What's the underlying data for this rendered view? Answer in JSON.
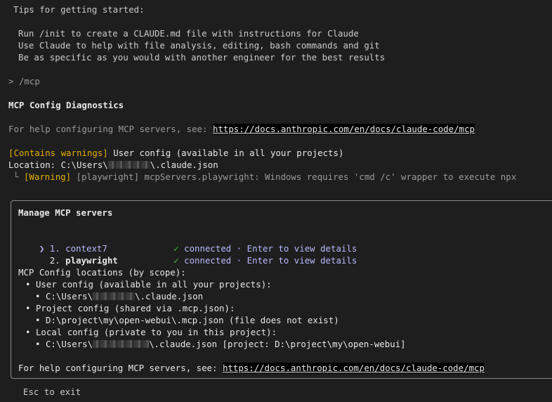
{
  "tips": {
    "heading": "Tips for getting started:",
    "items": [
      "Run /init to create a CLAUDE.md file with instructions for Claude",
      "Use Claude to help with file analysis, editing, bash commands and git",
      "Be as specific as you would with another engineer for the best results"
    ]
  },
  "prompt": {
    "symbol": ">",
    "command": "/mcp"
  },
  "diagnostics": {
    "title": "MCP Config Diagnostics",
    "help_prefix": "For help configuring MCP servers, see: ",
    "help_link": "https://docs.anthropic.com/en/docs/claude-code/mcp",
    "warning_tag": "[Contains warnings]",
    "warning_scope": " User config (available in all your projects)",
    "location_prefix": "Location: C:\\Users\\",
    "location_suffix": "\\.claude.json",
    "tree_glyph": "└",
    "item_tag": "[Warning]",
    "item_text": " [playwright] mcpServers.playwright: Windows requires 'cmd /c' wrapper to execute npx"
  },
  "panel": {
    "title": "Manage MCP servers",
    "servers": [
      {
        "pointer": "❯",
        "index": "1.",
        "name": "context7",
        "check": "✓",
        "status": "connected",
        "sep": "·",
        "action": "Enter to view details",
        "selected": true
      },
      {
        "pointer": " ",
        "index": "2.",
        "name": "playwright",
        "check": "✓",
        "status": "connected",
        "sep": "·",
        "action": "Enter to view details",
        "selected": false
      }
    ],
    "locations_heading": "MCP Config locations (by scope):",
    "scopes": [
      {
        "label": "User config (available in all your projects):",
        "path_prefix": "C:\\Users\\",
        "path_suffix": "\\.claude.json",
        "redacted": true
      },
      {
        "label": "Project config (shared via .mcp.json):",
        "path": "D:\\project\\my\\open-webui\\.mcp.json (file does not exist)",
        "redacted": false
      },
      {
        "label": "Local config (private to you in this project):",
        "path_prefix": "C:\\Users\\",
        "path_suffix": "\\.claude.json [project: D:\\project\\my\\open-webui]",
        "redacted": true
      }
    ],
    "bullet": "•",
    "help_prefix": "For help configuring MCP servers, see: ",
    "help_link": "https://docs.anthropic.com/en/docs/claude-code/mcp"
  },
  "footer": {
    "hint": "Esc to exit"
  }
}
